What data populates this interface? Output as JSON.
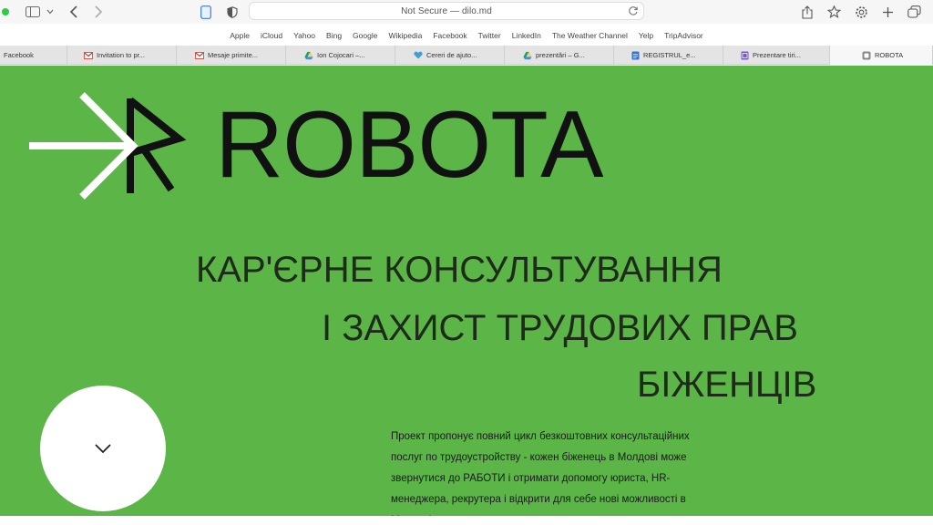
{
  "toolbar": {
    "address": "Not Secure — dilo.md"
  },
  "favorites": [
    "Apple",
    "iCloud",
    "Yahoo",
    "Bing",
    "Google",
    "Wikipedia",
    "Facebook",
    "Twitter",
    "LinkedIn",
    "The Weather Channel",
    "Yelp",
    "TripAdvisor"
  ],
  "tabs": [
    {
      "label": "Facebook",
      "icon": "none"
    },
    {
      "label": "Invitation to pr...",
      "icon": "gmail-icon"
    },
    {
      "label": "Mesaje primite...",
      "icon": "gmail-icon"
    },
    {
      "label": "Ion Cojocari –...",
      "icon": "google-drive-icon"
    },
    {
      "label": "Cereri de ajuto...",
      "icon": "heart-icon"
    },
    {
      "label": "prezentări – G...",
      "icon": "google-drive-icon"
    },
    {
      "label": "REGISTRUL_e...",
      "icon": "doc-icon"
    },
    {
      "label": "Prezentare tiri...",
      "icon": "form-icon"
    },
    {
      "label": "ROBOTA",
      "icon": "site-icon"
    }
  ],
  "page": {
    "brand": "ROBOTA",
    "headline_line1": "КАР'ЄРНЕ КОНСУЛЬТУВАННЯ",
    "headline_line2": "І ЗАХИСТ ТРУДОВИХ ПРАВ",
    "headline_line3": "БІЖЕНЦІВ",
    "description": "Проект пропонує повний цикл безкоштовних консультаційних послуг по трудоустройству - кожен біженець в Молдові може звернутися до РАБОТИ і отримати допомогу юриста, HR-менеджера, рекрутера і відкрити для себе нові можливості в Молдові."
  },
  "colors": {
    "page_background": "#5cb547",
    "text_dark": "#111111",
    "button_white": "#ffffff"
  }
}
